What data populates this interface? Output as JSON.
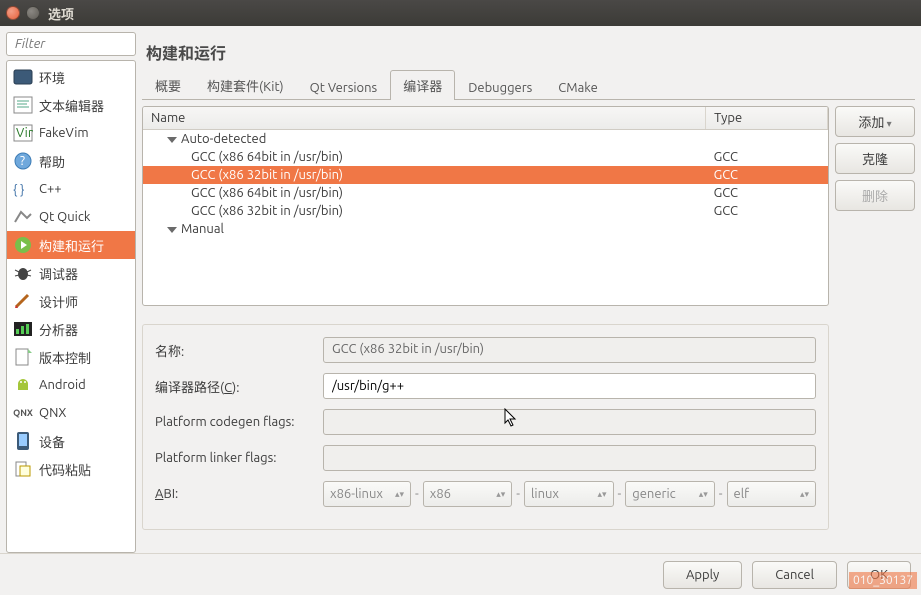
{
  "window": {
    "title": "选项"
  },
  "filter": {
    "placeholder": "Filter"
  },
  "categories": [
    {
      "id": "env",
      "label": "环境"
    },
    {
      "id": "text-editor",
      "label": "文本编辑器"
    },
    {
      "id": "fakevim",
      "label": "FakeVim"
    },
    {
      "id": "help",
      "label": "帮助"
    },
    {
      "id": "cpp",
      "label": "C++"
    },
    {
      "id": "qtquick",
      "label": "Qt Quick"
    },
    {
      "id": "build-run",
      "label": "构建和运行",
      "active": true
    },
    {
      "id": "debugger",
      "label": "调试器"
    },
    {
      "id": "designer",
      "label": "设计师"
    },
    {
      "id": "analyzer",
      "label": "分析器"
    },
    {
      "id": "vcs",
      "label": "版本控制"
    },
    {
      "id": "android",
      "label": "Android"
    },
    {
      "id": "qnx",
      "label": "QNX"
    },
    {
      "id": "devices",
      "label": "设备"
    },
    {
      "id": "paste",
      "label": "代码粘贴"
    }
  ],
  "page": {
    "title": "构建和运行"
  },
  "tabs": [
    {
      "id": "overview",
      "label": "概要"
    },
    {
      "id": "kits",
      "label": "构建套件(Kit)"
    },
    {
      "id": "qtversions",
      "label": "Qt Versions"
    },
    {
      "id": "compilers",
      "label": "编译器",
      "active": true
    },
    {
      "id": "debuggers",
      "label": "Debuggers"
    },
    {
      "id": "cmake",
      "label": "CMake"
    }
  ],
  "tree": {
    "headers": {
      "name": "Name",
      "type": "Type"
    },
    "groups": [
      {
        "label": "Auto-detected",
        "items": [
          {
            "name": "GCC (x86 64bit in /usr/bin)",
            "type": "GCC"
          },
          {
            "name": "GCC (x86 32bit in /usr/bin)",
            "type": "GCC",
            "selected": true
          },
          {
            "name": "GCC (x86 64bit in /usr/bin)",
            "type": "GCC"
          },
          {
            "name": "GCC (x86 32bit in /usr/bin)",
            "type": "GCC"
          }
        ]
      },
      {
        "label": "Manual",
        "items": []
      }
    ]
  },
  "sideButtons": {
    "add": "添加",
    "clone": "克隆",
    "delete": "删除"
  },
  "form": {
    "name_label": "名称:",
    "name_value": "GCC (x86 32bit in /usr/bin)",
    "path_label_pre": "编译器路径(",
    "path_label_u": "C",
    "path_label_post": "):",
    "path_value": "/usr/bin/g++",
    "codegen_label": "Platform codegen flags:",
    "codegen_value": "",
    "linker_label": "Platform linker flags:",
    "linker_value": "",
    "abi_label_pre": "",
    "abi_label_u": "A",
    "abi_label_post": "BI:",
    "abi_main": "x86-linux",
    "abi_parts": [
      "x86",
      "linux",
      "generic",
      "elf"
    ]
  },
  "footer": {
    "apply": "Apply",
    "cancel": "Cancel",
    "ok": "OK"
  },
  "watermark": "010_30137"
}
